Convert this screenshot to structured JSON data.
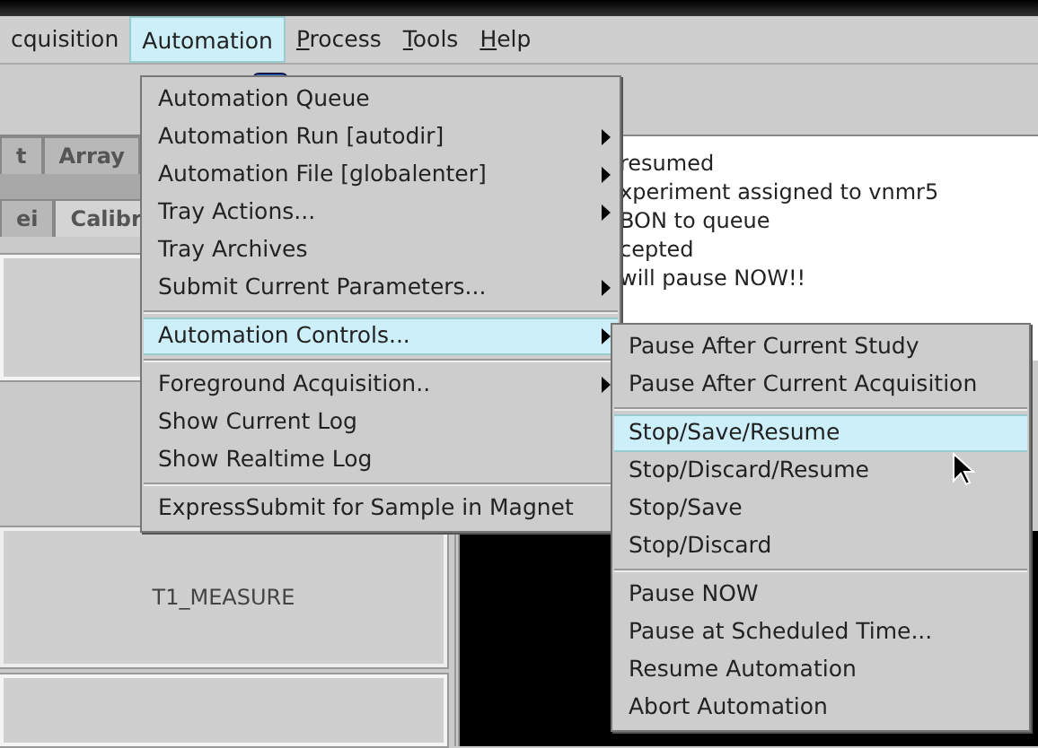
{
  "menubar": [
    {
      "label": "cquisition",
      "selected": false,
      "mnemonic": false
    },
    {
      "label": "Automation",
      "selected": true,
      "mnemonic": false
    },
    {
      "label": "Process",
      "selected": false,
      "mnemonic": true
    },
    {
      "label": "Tools",
      "selected": false,
      "mnemonic": true
    },
    {
      "label": "Help",
      "selected": false,
      "mnemonic": true
    }
  ],
  "tabs_top": [
    {
      "label": "t",
      "selected": false
    },
    {
      "label": "Array",
      "selected": false
    }
  ],
  "tabs_bottom": [
    {
      "label": "ei",
      "selected": false
    },
    {
      "label": "Calibr",
      "selected": true
    }
  ],
  "panel_buttons": [
    {
      "kind": "blank"
    },
    {
      "kind": "labeled",
      "label": "T1_MEASURE"
    },
    {
      "kind": "blank"
    }
  ],
  "log_lines": [
    "resumed",
    "xperiment assigned to vnmr5",
    "BON to queue",
    "cepted",
    "will pause NOW!!"
  ],
  "automation_menu": [
    [
      {
        "label": "Automation Queue",
        "submenu": false,
        "selected": false
      },
      {
        "label": "Automation Run [autodir]",
        "submenu": true,
        "selected": false
      },
      {
        "label": "Automation File [globalenter]",
        "submenu": true,
        "selected": false
      },
      {
        "label": "Tray Actions...",
        "submenu": true,
        "selected": false
      },
      {
        "label": "Tray Archives",
        "submenu": false,
        "selected": false
      },
      {
        "label": "Submit Current Parameters...",
        "submenu": true,
        "selected": false
      }
    ],
    [
      {
        "label": "Automation Controls...",
        "submenu": true,
        "selected": true
      }
    ],
    [
      {
        "label": "Foreground Acquisition..",
        "submenu": true,
        "selected": false
      },
      {
        "label": "Show Current Log",
        "submenu": false,
        "selected": false
      },
      {
        "label": "Show Realtime Log",
        "submenu": false,
        "selected": false
      }
    ],
    [
      {
        "label": "ExpressSubmit for Sample in Magnet",
        "submenu": false,
        "selected": false
      }
    ]
  ],
  "controls_submenu": [
    [
      {
        "label": "Pause After Current Study",
        "selected": false
      },
      {
        "label": "Pause After Current Acquisition",
        "selected": false
      }
    ],
    [
      {
        "label": "Stop/Save/Resume",
        "selected": true
      },
      {
        "label": "Stop/Discard/Resume",
        "selected": false
      },
      {
        "label": "Stop/Save",
        "selected": false
      },
      {
        "label": "Stop/Discard",
        "selected": false
      }
    ],
    [
      {
        "label": "Pause NOW",
        "selected": false
      },
      {
        "label": "Pause at Scheduled Time...",
        "selected": false
      },
      {
        "label": "Resume Automation",
        "selected": false
      },
      {
        "label": "Abort Automation",
        "selected": false
      }
    ]
  ]
}
